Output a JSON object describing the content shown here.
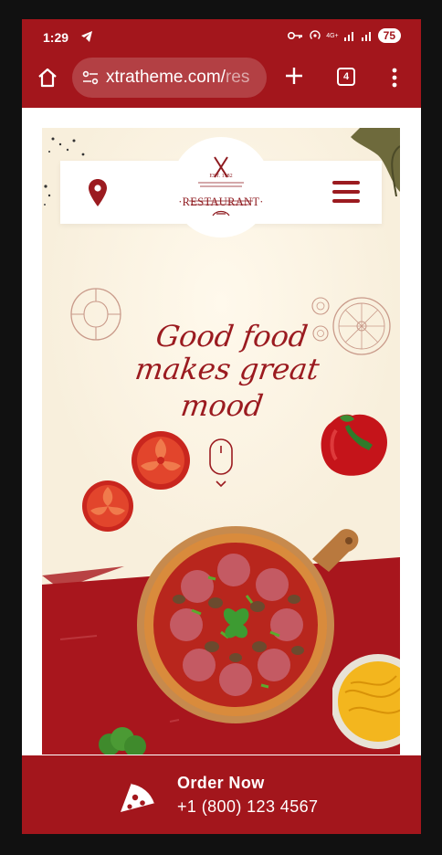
{
  "status_bar": {
    "time": "1:29",
    "battery": "75",
    "network": "4G+"
  },
  "browser": {
    "url_main": "xtratheme.com/",
    "url_faded": "res",
    "tab_count": "4"
  },
  "site": {
    "logo_text": "·RESTAURANT·",
    "logo_est": "EST.   1982",
    "tagline_line1": "Good food",
    "tagline_line2": "makes great mood"
  },
  "order": {
    "title": "Order Now",
    "phone": "+1 (800) 123 4567"
  },
  "colors": {
    "brand_red": "#a3161c",
    "cream": "#f8efdc",
    "text_red": "#9b1b20"
  },
  "icons": {
    "home": "home-icon",
    "site_settings": "tune-icon",
    "new_tab": "plus-icon",
    "menu": "more-vert-icon",
    "location": "location-pin-icon",
    "nav": "hamburger-icon",
    "scroll": "mouse-scroll-icon",
    "order": "pizza-slice-icon"
  }
}
